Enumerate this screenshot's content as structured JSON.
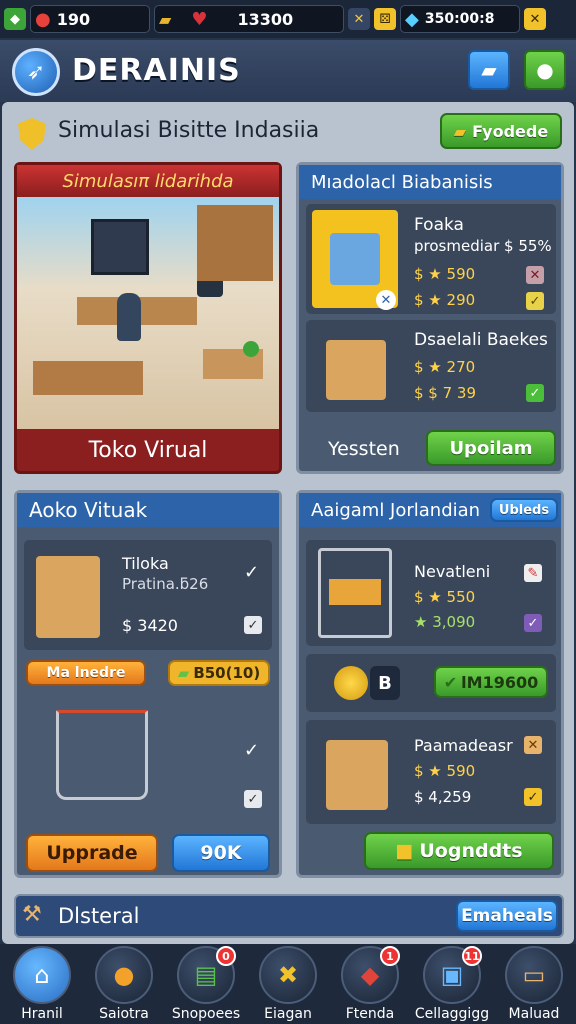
{
  "resources": [
    {
      "icon": "leaf-icon",
      "value": ""
    },
    {
      "icon": "strawberry-icon",
      "value": "190"
    },
    {
      "icon": "gold-bars-icon",
      "value": ""
    },
    {
      "icon": "heart-icon",
      "value": "13300"
    },
    {
      "icon": "crossed-icon",
      "value": ""
    },
    {
      "icon": "dice-icon",
      "value": ""
    },
    {
      "icon": "gem-icon",
      "value": "350:00:8"
    },
    {
      "icon": "close-icon",
      "value": ""
    }
  ],
  "header": {
    "brand": "DERAINIS"
  },
  "section": {
    "title": "Simulasi Bisitte Indasiia",
    "action": "Fyodede"
  },
  "featured": {
    "title": "Simulasıπ lidarihda",
    "caption": "Toko Virual"
  },
  "modal_panel": {
    "title": "Mıadolacl Biabanisis",
    "item1": {
      "name": "Foaka",
      "desc": "prosmediar $ 55%",
      "line1": "$ ★ 590",
      "line2": "$ ★ 290"
    },
    "item2": {
      "name": "Dsaelali Baekes",
      "line1": "$ ★ 270",
      "line2": "$ $ 7 39"
    },
    "label": "Yessten",
    "button": "Upoilam"
  },
  "left_panel": {
    "title": "Aoko Vituak",
    "item": {
      "name": "Tiloka",
      "desc": "Pratina.ƃ26",
      "price": "$ 3420"
    },
    "mini_button": "Ma lnedre",
    "price_tag": "B50(10)",
    "upgrade": "Upprade",
    "ok": "90K"
  },
  "right_panel": {
    "title": "Aaigaml Jorlandian",
    "tag": "Ubleds",
    "item1": {
      "name": "Nevatleni",
      "line1": "$ ★ 550",
      "line2": "★ 3,090"
    },
    "coin_label": "B",
    "coin_value": "lM19600",
    "item2": {
      "name": "Paamadeasr",
      "line1": "$ ★ 590",
      "line2": "$ 4,259"
    },
    "button": "Uognddts"
  },
  "footer_bar": {
    "title": "Dlsteral",
    "button": "Emaheals"
  },
  "nav": [
    {
      "label": "Hranil",
      "icon": "shop-icon",
      "badge": ""
    },
    {
      "label": "Saiotra",
      "icon": "cookie-icon",
      "badge": ""
    },
    {
      "label": "Snopoees",
      "icon": "cash-register-icon",
      "badge": "0"
    },
    {
      "label": "Eiagan",
      "icon": "tools-icon",
      "badge": ""
    },
    {
      "label": "Ftenda",
      "icon": "tag-icon",
      "badge": "1"
    },
    {
      "label": "Cellaggigg",
      "icon": "camera-icon",
      "badge": "11"
    },
    {
      "label": "Maluad",
      "icon": "sign-icon",
      "badge": ""
    }
  ]
}
